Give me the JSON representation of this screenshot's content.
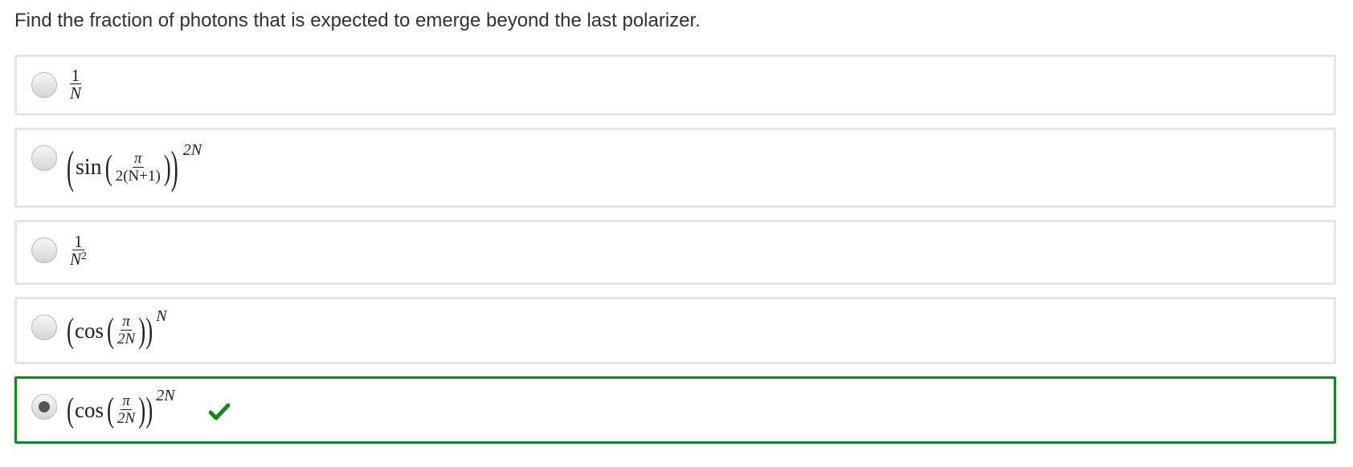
{
  "question": "Find the fraction of photons that is expected to emerge beyond the last polarizer.",
  "choices": [
    {
      "id": "a",
      "expr": "1/N",
      "num": "1",
      "den": "N"
    },
    {
      "id": "b",
      "expr": "(sin(π/(2(N+1))))^2N",
      "fn": "sin",
      "num": "π",
      "den": "2(N+1)",
      "exp": "2N"
    },
    {
      "id": "c",
      "expr": "1/N^2",
      "num": "1",
      "den": "N",
      "den_exp": "2"
    },
    {
      "id": "d",
      "expr": "(cos(π/2N))^N",
      "fn": "cos",
      "num": "π",
      "den": "2N",
      "exp": "N"
    },
    {
      "id": "e",
      "expr": "(cos(π/2N))^2N",
      "fn": "cos",
      "num": "π",
      "den": "2N",
      "exp": "2N",
      "selected": true,
      "correct": true
    }
  ],
  "colors": {
    "correct": "#0e8a16",
    "border": "#e6e6e6"
  },
  "icons": {
    "correct": "checkmark-icon"
  }
}
